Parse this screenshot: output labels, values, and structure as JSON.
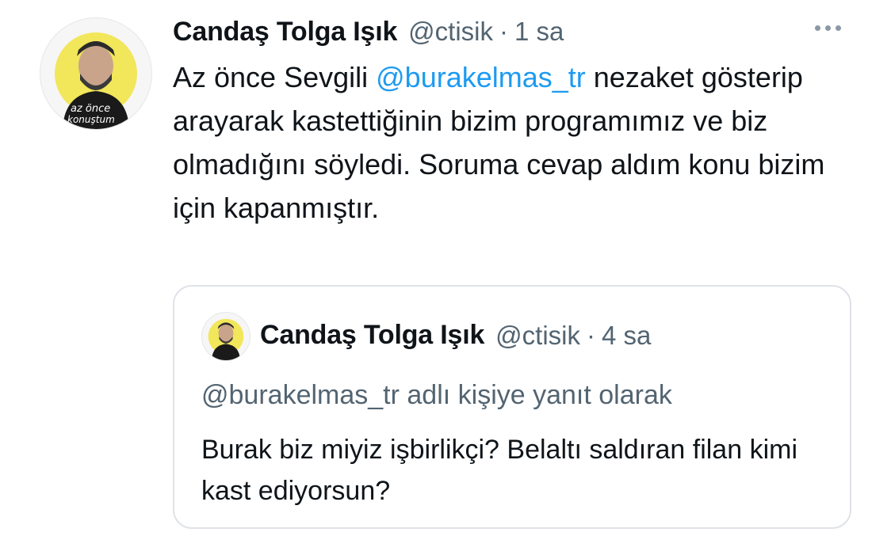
{
  "tweet": {
    "author_name": "Candaş Tolga Işık",
    "author_handle": "@ctisik",
    "separator": "·",
    "time": "1 sa",
    "text_before": "Az önce Sevgili ",
    "mention": "@burakelmas_tr",
    "text_after": " nezaket gösterip arayarak kastettiğinin bizim programımız ve biz olmadığını söyledi. Soruma cevap aldım konu bizim için kapanmıştır.",
    "avatar_text": [
      "az önce",
      "konuştum"
    ]
  },
  "quote": {
    "author_name": "Candaş Tolga Işık",
    "author_handle": "@ctisik",
    "separator": "·",
    "time": "4 sa",
    "reply_to": "@burakelmas_tr adlı kişiye yanıt olarak",
    "text": "Burak biz miyiz işbirlikçi? Belaltı saldıran filan kimi kast ediyorsun?"
  },
  "icons": {
    "more": "more-horizontal-icon"
  },
  "colors": {
    "text": "#0f1419",
    "secondary": "#536471",
    "link": "#1d9bf0",
    "border": "#dfe3e7",
    "avatar_accent": "#f2e65a"
  }
}
